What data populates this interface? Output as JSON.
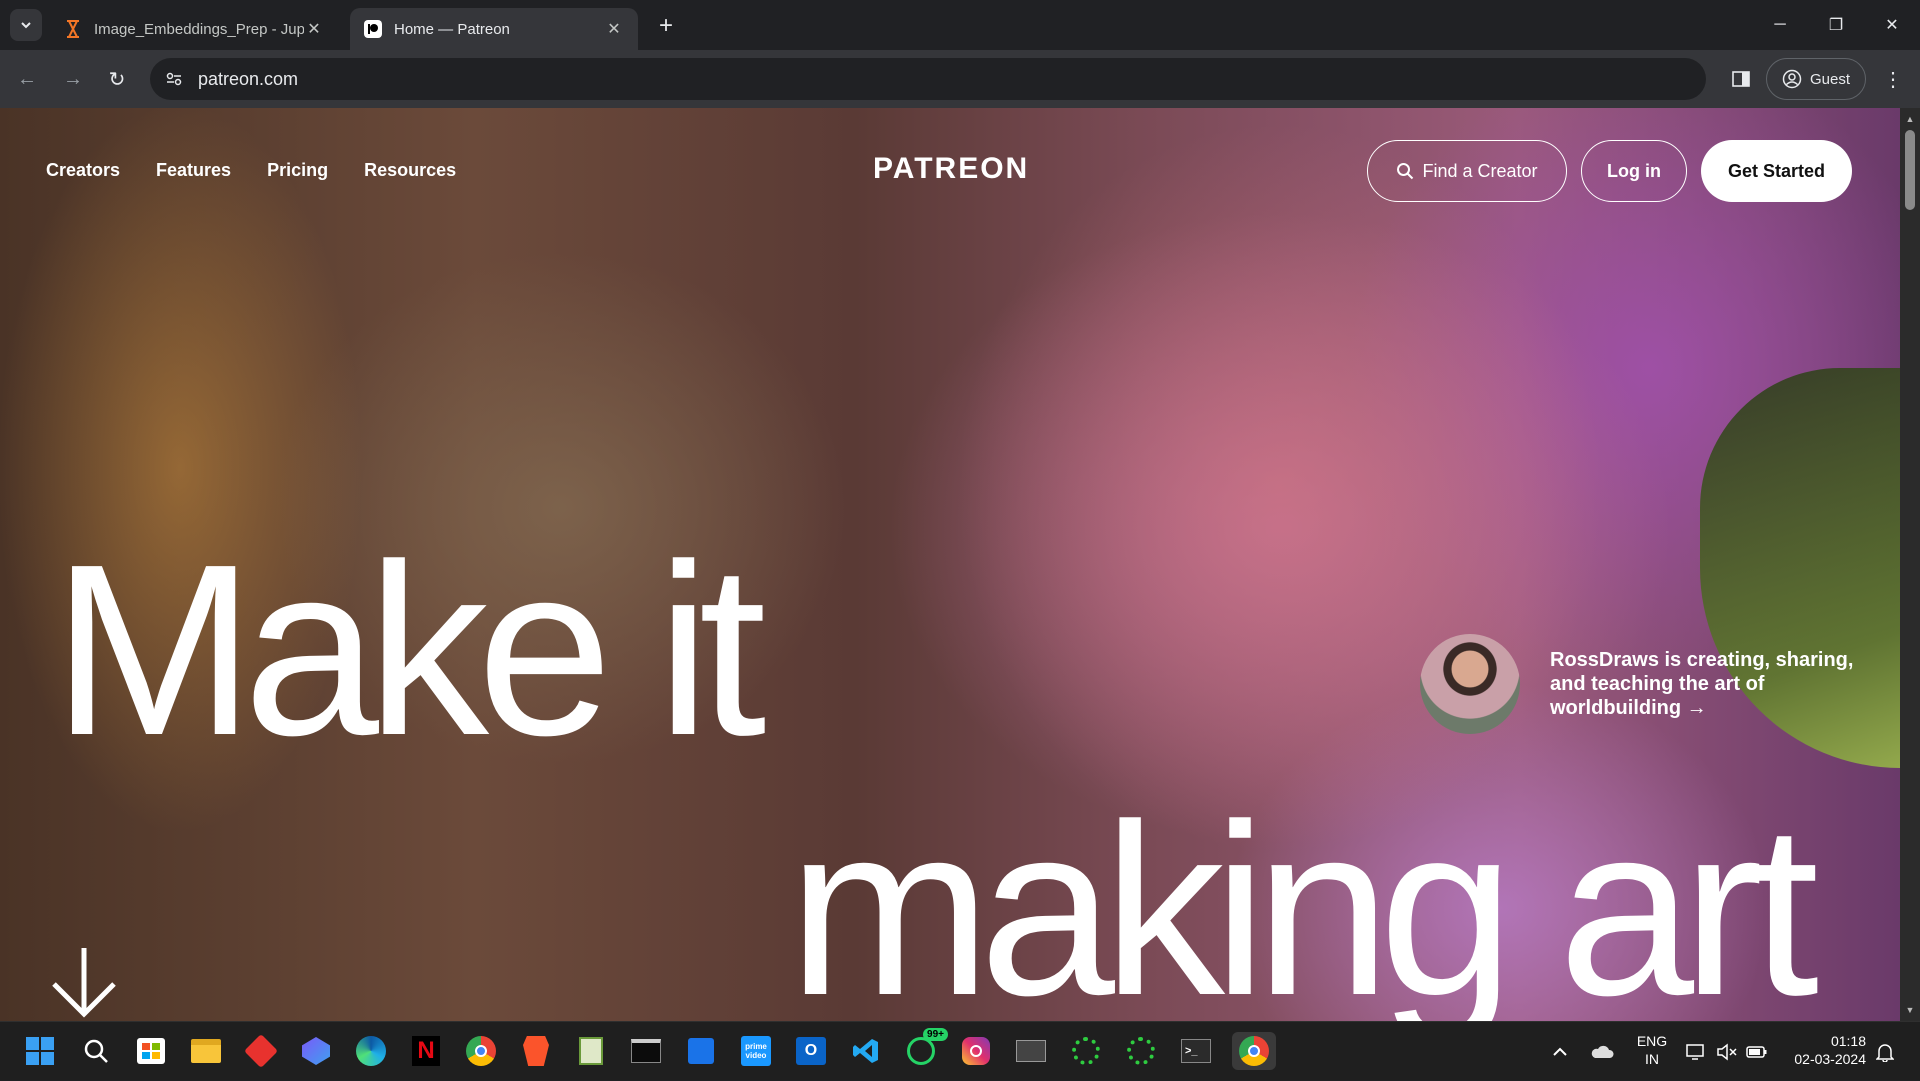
{
  "browser": {
    "tabs": [
      {
        "title": "Image_Embeddings_Prep - Jupyter",
        "active": false
      },
      {
        "title": "Home — Patreon",
        "active": true
      }
    ],
    "url": "patreon.com",
    "profile_label": "Guest"
  },
  "page": {
    "nav": [
      "Creators",
      "Features",
      "Pricing",
      "Resources"
    ],
    "logo": "PATREON",
    "find_creator": "Find a Creator",
    "login": "Log in",
    "get_started": "Get Started",
    "hero_line1": "Make it",
    "hero_line2": "making art",
    "featured_creator": "RossDraws is creating, sharing, and teaching the art of worldbuilding →"
  },
  "taskbar": {
    "apps": [
      "start",
      "search",
      "store",
      "file-explorer",
      "app-red",
      "copilot",
      "edge",
      "netflix",
      "chrome",
      "brave",
      "notepad",
      "terminal",
      "files-blue",
      "prime-video",
      "outlook",
      "vscode",
      "whatsapp",
      "instagram",
      "window-app",
      "spinner-app",
      "spinner-app-2",
      "cmd",
      "chrome-active"
    ],
    "whatsapp_badge": "99+",
    "lang_line1": "ENG",
    "lang_line2": "IN",
    "time": "01:18",
    "date": "02-03-2024"
  },
  "colors": {
    "chrome_bg": "#202124",
    "toolbar_bg": "#35363a",
    "button_white": "#ffffff",
    "taskbar_bg": "#1f1f1f"
  }
}
